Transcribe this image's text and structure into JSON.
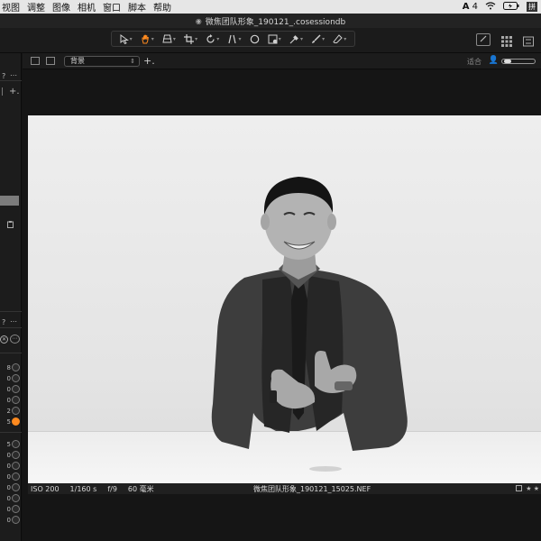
{
  "menu": {
    "items": [
      "视图",
      "调整",
      "图像",
      "相机",
      "窗口",
      "脚本",
      "帮助"
    ],
    "right_items": {
      "adobe_count": "4",
      "input_method": "拼"
    }
  },
  "window": {
    "title": "微焦团队形象_190121_.cosessiondb"
  },
  "toolbar": {
    "tools": [
      "select-cursor-icon",
      "hand-pan-icon",
      "keystone-icon",
      "crop-icon",
      "rotate-icon",
      "straighten-icon",
      "circle-mask-icon",
      "mask-icon",
      "picker-icon",
      "brush-icon",
      "eraser-icon"
    ],
    "active_tool": "hand-pan-icon"
  },
  "left_panel": {
    "labels_top": [
      "?",
      "⋯"
    ],
    "plus": "+.",
    "labels_mid": [
      "?",
      "⋯"
    ],
    "slider_group_1": [
      "8",
      "0",
      "0",
      "0",
      "2",
      "5"
    ],
    "slider_group_2": [
      "5",
      "0",
      "0",
      "0",
      "0",
      "0",
      "0",
      "0"
    ]
  },
  "viewer_bar": {
    "layer_select": "背景",
    "add_layer": "+.",
    "fit_label": "适合"
  },
  "info_bar": {
    "iso": "ISO 200",
    "shutter": "1/160 s",
    "aperture": "f/9",
    "focal": "60 毫米",
    "filename": "微焦团队形象_190121_15025.NEF",
    "rating": "★ ★"
  },
  "colors": {
    "accent": "#ff8a1f"
  }
}
